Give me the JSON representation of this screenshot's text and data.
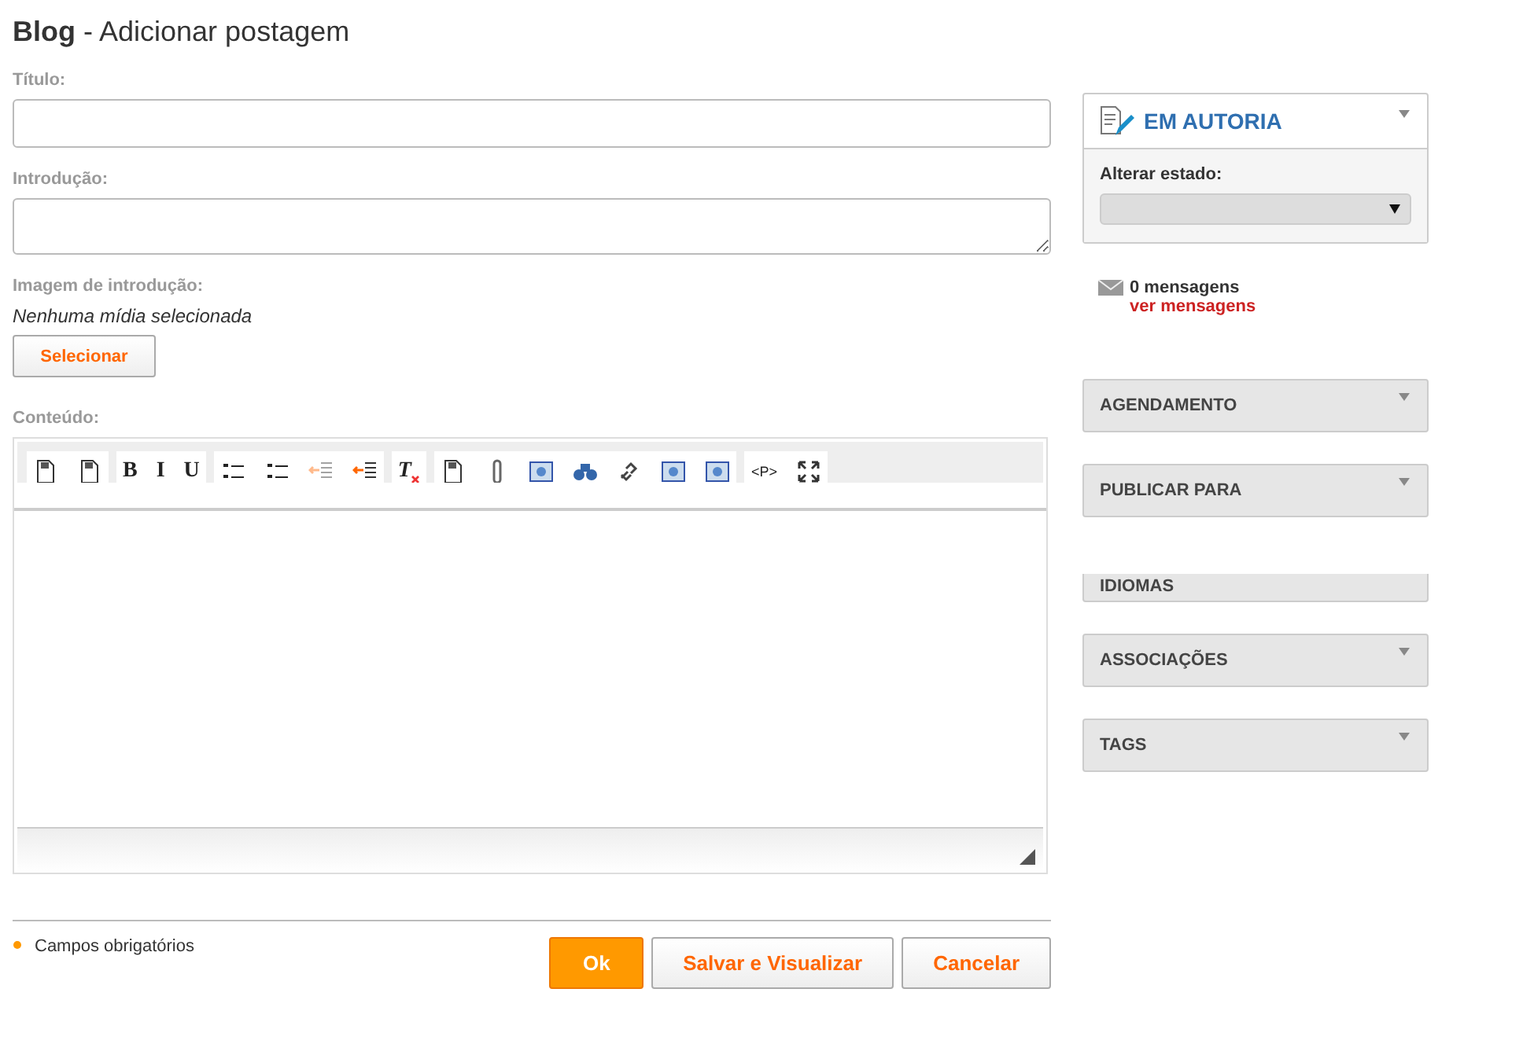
{
  "page_title": {
    "section": "Blog",
    "action": " - Adicionar postagem"
  },
  "fields": [
    {
      "label": "Título:",
      "kind": "input"
    },
    {
      "label": "Introdução:",
      "kind": "textarea"
    }
  ],
  "intro_image": {
    "label": "Imagem de introdução:",
    "status": "Nenhuma mídia selecionada",
    "button": "Selecionar"
  },
  "content": {
    "label": "Conteúdo:",
    "toolbar": [
      [
        {
          "kind": "icon"
        },
        {
          "kind": "icon"
        }
      ],
      [
        {
          "kind": "letter",
          "label": "B"
        },
        {
          "kind": "letter",
          "label": "I"
        },
        {
          "kind": "letter",
          "label": "U"
        }
      ],
      [
        {
          "kind": "icon"
        },
        {
          "kind": "icon"
        },
        {
          "kind": "icon",
          "disabled": true
        },
        {
          "kind": "icon",
          "disabled": false
        }
      ],
      [
        {
          "kind": "clear",
          "label": "T"
        }
      ],
      [
        {
          "kind": "icon"
        },
        {
          "kind": "icon"
        },
        {
          "kind": "icon"
        },
        {
          "kind": "icon"
        },
        {
          "kind": "icon"
        },
        {
          "kind": "icon"
        },
        {
          "kind": "icon"
        }
      ],
      [
        {
          "kind": "letter",
          "label": "<P>"
        },
        {
          "kind": "icon"
        }
      ]
    ]
  },
  "required_note": "Campos obrigatórios",
  "buttons": [
    {
      "label": "Ok",
      "primary": true
    },
    {
      "label": "Salvar e Visualizar",
      "primary": false
    },
    {
      "label": "Cancelar",
      "primary": false
    }
  ],
  "status_panel": {
    "title": "EM AUTORIA",
    "state_label": "Alterar estado:"
  },
  "messages": {
    "count": "0 mensagens",
    "link": "ver mensagens"
  },
  "panels": [
    {
      "title": "AGENDAMENTO",
      "clipped": false
    },
    {
      "title": "PUBLICAR PARA",
      "clipped": false
    },
    {
      "title": "IDIOMAS",
      "clipped": true
    },
    {
      "title": "ASSOCIAÇÕES",
      "clipped": false
    },
    {
      "title": "TAGS",
      "clipped": false
    }
  ]
}
